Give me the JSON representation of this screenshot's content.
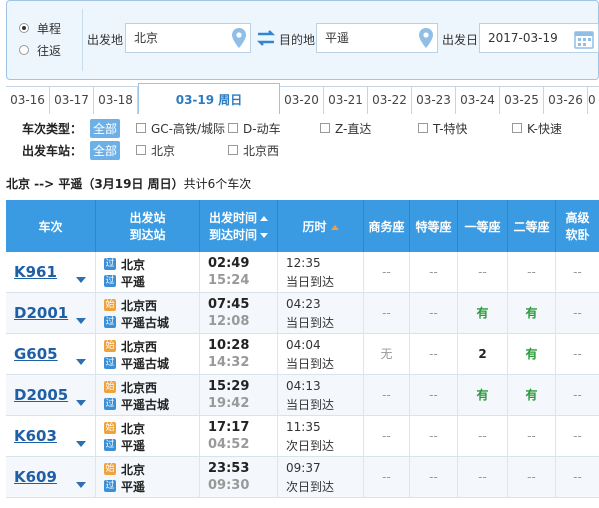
{
  "search": {
    "trip_types": [
      "单程",
      "往返"
    ],
    "selected_trip": 0,
    "from_label": "出发地",
    "from_value": "北京",
    "to_label": "目的地",
    "to_value": "平遥",
    "date_label": "出发日",
    "date_value": "2017-03-19"
  },
  "date_tabs": [
    "03-16",
    "03-17",
    "03-18",
    "03-19 周日",
    "03-20",
    "03-21",
    "03-22",
    "03-23",
    "03-24",
    "03-25",
    "03-26",
    "0"
  ],
  "active_tab": 3,
  "filters": {
    "train_type_label": "车次类型：",
    "station_label": "出发车站：",
    "all_label": "全部",
    "train_types": [
      "GC-高铁/城际",
      "D-动车",
      "Z-直达",
      "T-特快",
      "K-快速"
    ],
    "stations": [
      "北京",
      "北京西"
    ]
  },
  "summary": {
    "route": "北京 --> 平遥（3月19日  周日）",
    "count": "共计6个车次"
  },
  "table": {
    "headers": {
      "train": "车次",
      "station_1": "出发站",
      "station_2": "到达站",
      "time_1": "出发时间",
      "time_2": "到达时间",
      "duration": "历时",
      "business": "商务座",
      "special": "特等座",
      "first": "一等座",
      "second": "二等座",
      "soft_1": "高级",
      "soft_2": "软卧"
    },
    "badges": {
      "start": "始",
      "pass": "过"
    },
    "rows": [
      {
        "train": "K961",
        "from": "北京",
        "from_badge": "过",
        "to": "平遥",
        "to_badge": "过",
        "dep": "02:49",
        "arr": "15:24",
        "duration": "12:35",
        "arrive_day": "当日到达",
        "business": "--",
        "special": "--",
        "first": "--",
        "second": "--",
        "soft": "--"
      },
      {
        "train": "D2001",
        "from": "北京西",
        "from_badge": "始",
        "to": "平遥古城",
        "to_badge": "过",
        "dep": "07:45",
        "arr": "12:08",
        "duration": "04:23",
        "arrive_day": "当日到达",
        "business": "--",
        "special": "--",
        "first": "有",
        "second": "有",
        "soft": "--"
      },
      {
        "train": "G605",
        "from": "北京西",
        "from_badge": "始",
        "to": "平遥古城",
        "to_badge": "过",
        "dep": "10:28",
        "arr": "14:32",
        "duration": "04:04",
        "arrive_day": "当日到达",
        "business": "无",
        "special": "--",
        "first": "2",
        "second": "有",
        "soft": "--"
      },
      {
        "train": "D2005",
        "from": "北京西",
        "from_badge": "始",
        "to": "平遥古城",
        "to_badge": "过",
        "dep": "15:29",
        "arr": "19:42",
        "duration": "04:13",
        "arrive_day": "当日到达",
        "business": "--",
        "special": "--",
        "first": "有",
        "second": "有",
        "soft": "--"
      },
      {
        "train": "K603",
        "from": "北京",
        "from_badge": "始",
        "to": "平遥",
        "to_badge": "过",
        "dep": "17:17",
        "arr": "04:52",
        "duration": "11:35",
        "arrive_day": "次日到达",
        "business": "--",
        "special": "--",
        "first": "--",
        "second": "--",
        "soft": "--"
      },
      {
        "train": "K609",
        "from": "北京",
        "from_badge": "始",
        "to": "平遥",
        "to_badge": "过",
        "dep": "23:53",
        "arr": "09:30",
        "duration": "09:37",
        "arrive_day": "次日到达",
        "business": "--",
        "special": "--",
        "first": "--",
        "second": "--",
        "soft": "--"
      }
    ]
  },
  "colors": {
    "header_blue": "#3a9ae2",
    "available_green": "#2b9a3a",
    "train_link": "#1f5fa6"
  }
}
